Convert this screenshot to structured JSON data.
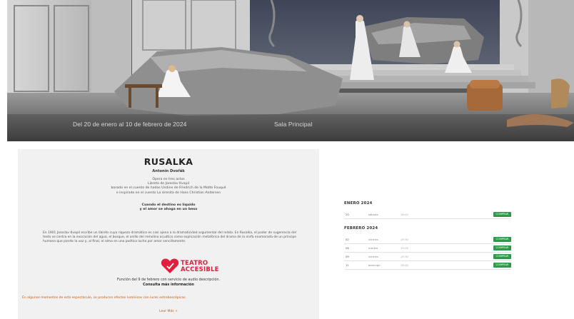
{
  "hero": {
    "dates": "Del 20 de enero al 10 de febrero de 2024",
    "venue": "Sala Principal"
  },
  "info": {
    "title": "RUSALKA",
    "composer": "Antonín Dvořák",
    "credits": [
      "Ópera en tres actos",
      "Libreto de Jaroslav Kvapil",
      "basado en el cuento de hadas Undine de Friedrich de la Motte Fouqué",
      "e inspirado en el cuento La sirenita de Hans Christian Andersen"
    ],
    "tagline": [
      "Cuando el destino es líquido",
      "y el amor se ahoga en un beso"
    ],
    "synopsis": "En 1901 Jaroslav Kvapil escribe un libreto cuya riqueza dramática es casi ajena a la dramaticidad argumental del relato. En Rusalka, el poder de sugerencia del texto se centra en la evocación del agua, el bosque, el anillo del remolino acuático como explicación metafórica del drama de la ninfa enamorada de un príncipe humano que pierde la voz y, al final, el alma en una poética lucha por amor sencillamente.",
    "logo": {
      "line1": "TEATRO",
      "line2": "ACCESIBLE",
      "icon": "heart-icon"
    },
    "function_note": "Función del 9 de febrero con servicio de audio descripción.",
    "consult_link": "Consulta más información",
    "warning": "En algunos momentos de este espectáculo, se producen efectos lumínicos con luces estroboscópicas.",
    "read_more": "Leer Más +"
  },
  "calendar": {
    "months": [
      {
        "name": "ENERO 2024",
        "rows": [
          {
            "day": "20",
            "weekday": "sábado",
            "time": "18:00",
            "button": "COMPRAR"
          }
        ]
      },
      {
        "name": "FEBRERO 2024",
        "rows": [
          {
            "day": "02",
            "weekday": "viernes",
            "time": "19:30",
            "button": "COMPRAR"
          },
          {
            "day": "06",
            "weekday": "martes",
            "time": "19:30",
            "button": "COMPRAR"
          },
          {
            "day": "09",
            "weekday": "viernes",
            "time": "19:30",
            "button": "COMPRAR"
          },
          {
            "day": "11",
            "weekday": "domingo",
            "time": "18:00",
            "button": "COMPRAR"
          }
        ]
      }
    ]
  },
  "colors": {
    "accent": "#c25b12",
    "buy": "#2e9a47",
    "logo": "#e31d3c",
    "panel": "#f1f1f1"
  }
}
